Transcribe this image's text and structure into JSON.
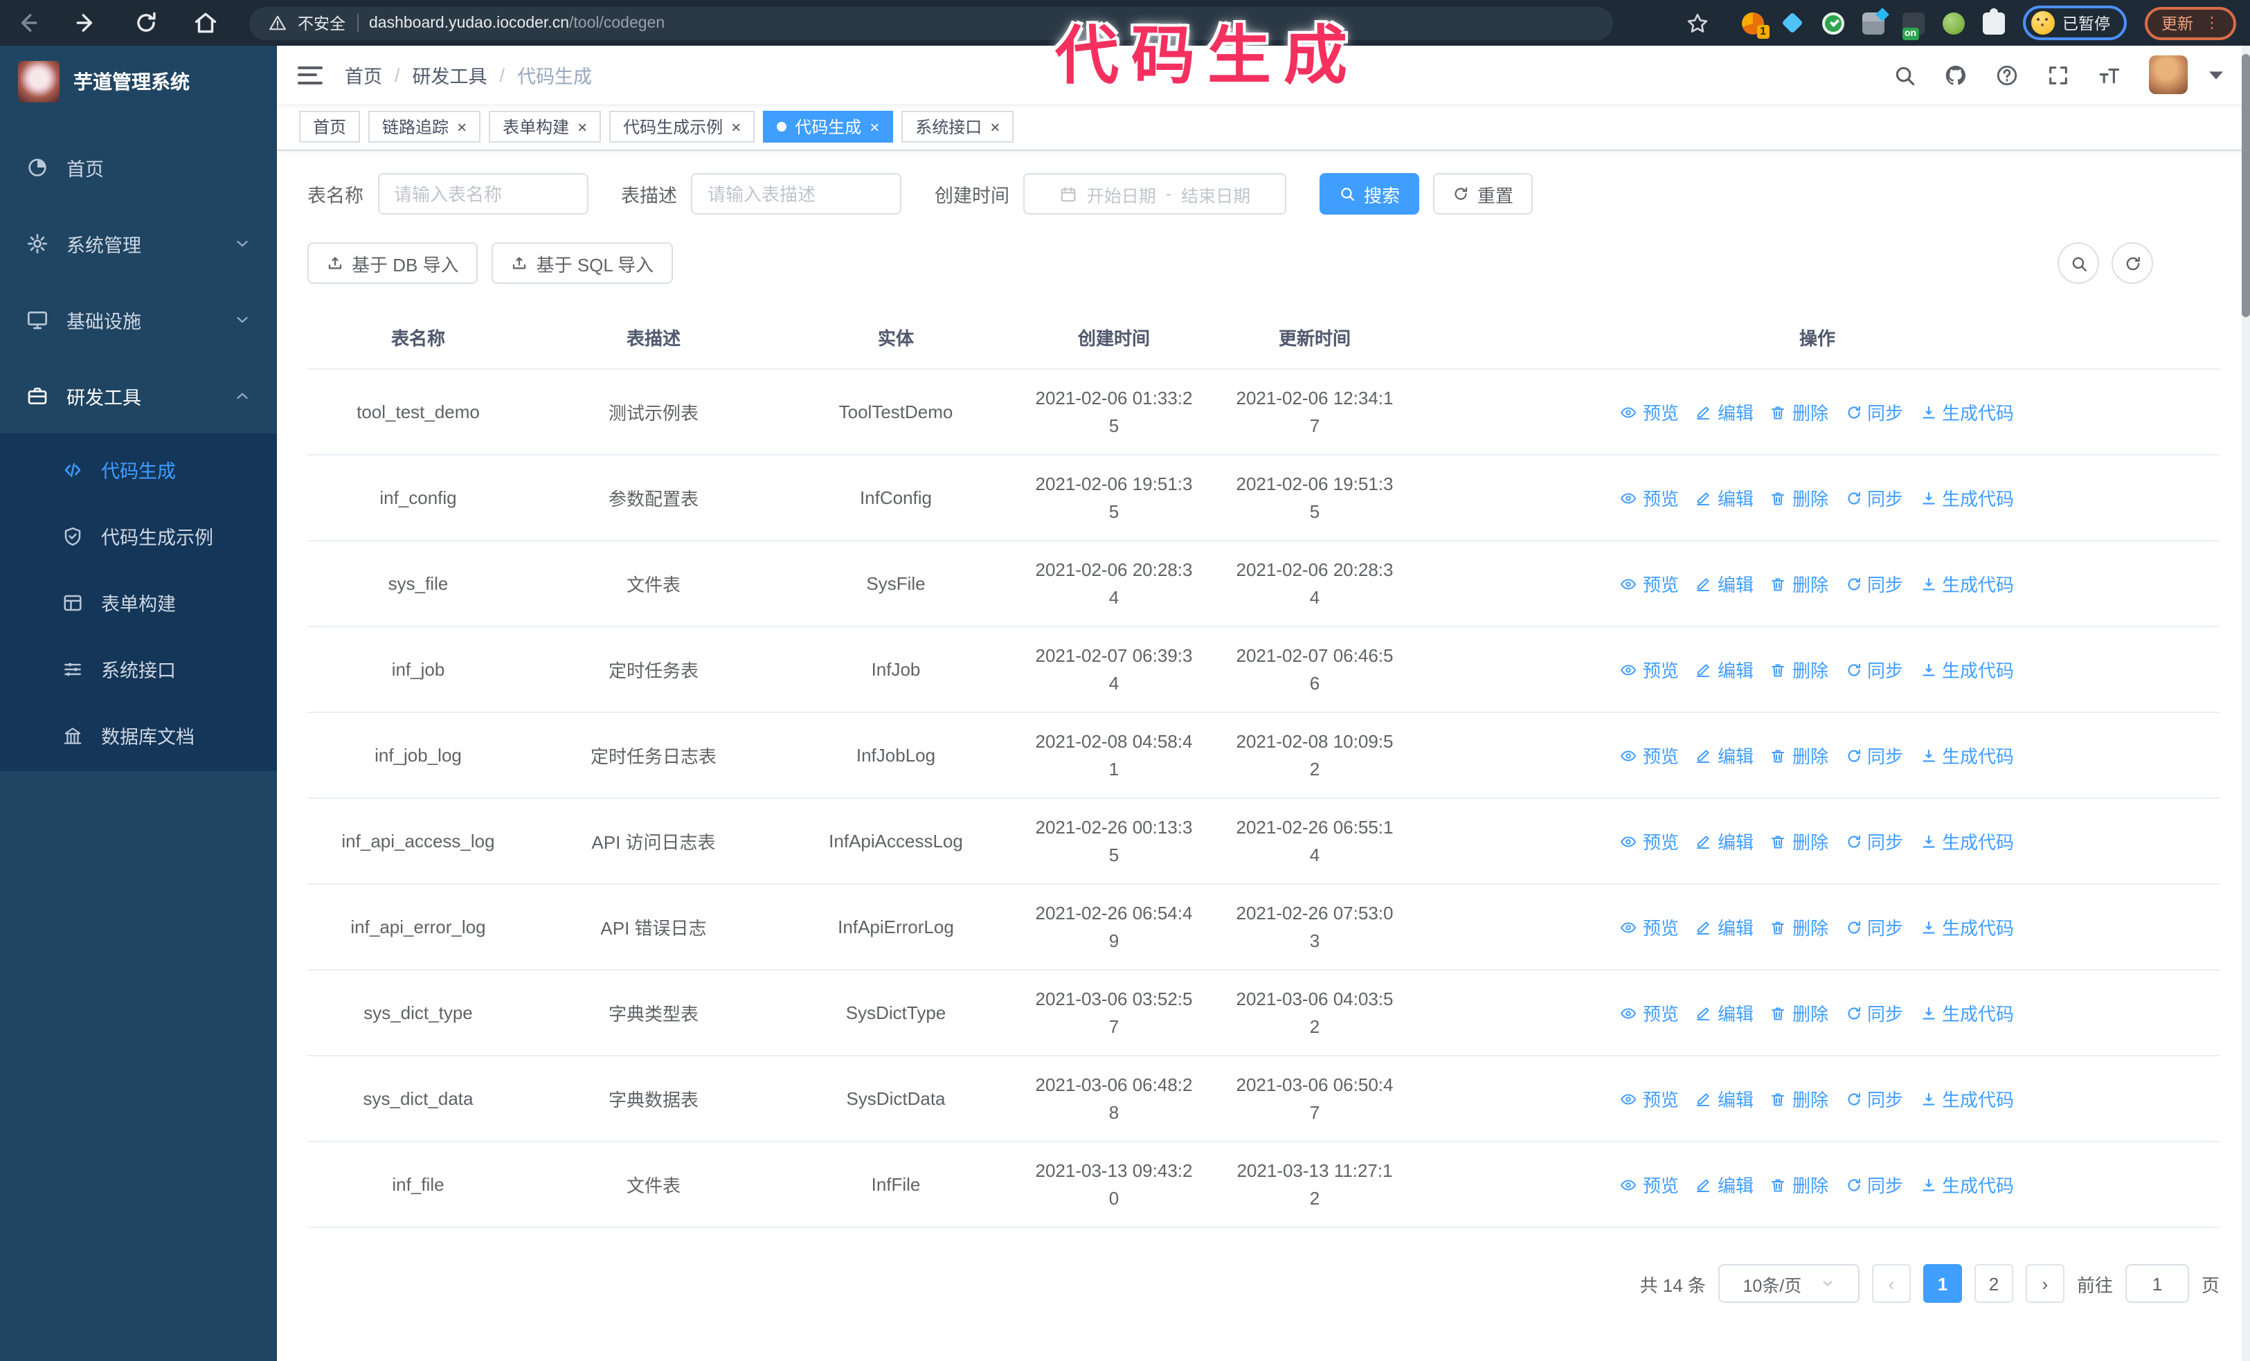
{
  "browser": {
    "security": "不安全",
    "host": "dashboard.yudao.iocoder.cn",
    "path": "/tool/codegen",
    "ext_badge": "1",
    "on_badge": "on",
    "paused": "已暂停",
    "update": "更新",
    "menu_glyph": "⋮"
  },
  "annotation": {
    "text": "代码生成"
  },
  "sidebar": {
    "title": "芋道管理系统",
    "items": [
      {
        "id": "home",
        "label": "首页",
        "icon": "dashboard",
        "expandable": false,
        "expanded": false
      },
      {
        "id": "system",
        "label": "系统管理",
        "icon": "gear",
        "expandable": true,
        "expanded": false
      },
      {
        "id": "infra",
        "label": "基础设施",
        "icon": "monitor",
        "expandable": true,
        "expanded": false
      },
      {
        "id": "dev-tools",
        "label": "研发工具",
        "icon": "toolbox",
        "expandable": true,
        "expanded": true
      }
    ],
    "submenu": [
      {
        "id": "codegen",
        "label": "代码生成",
        "icon": "code",
        "active": true
      },
      {
        "id": "codegen-example",
        "label": "代码生成示例",
        "icon": "shield",
        "active": false
      },
      {
        "id": "form-builder",
        "label": "表单构建",
        "icon": "form",
        "active": false
      },
      {
        "id": "system-api",
        "label": "系统接口",
        "icon": "sliders",
        "active": false
      },
      {
        "id": "db-doc",
        "label": "数据库文档",
        "icon": "bank",
        "active": false
      }
    ]
  },
  "topbar": {
    "breadcrumb": [
      "首页",
      "研发工具",
      "代码生成"
    ],
    "separator": "/"
  },
  "tabs": [
    {
      "label": "首页",
      "closable": false,
      "active": false
    },
    {
      "label": "链路追踪",
      "closable": true,
      "active": false
    },
    {
      "label": "表单构建",
      "closable": true,
      "active": false
    },
    {
      "label": "代码生成示例",
      "closable": true,
      "active": false
    },
    {
      "label": "代码生成",
      "closable": true,
      "active": true
    },
    {
      "label": "系统接口",
      "closable": true,
      "active": false
    }
  ],
  "search": {
    "table_name_label": "表名称",
    "table_name_placeholder": "请输入表名称",
    "table_desc_label": "表描述",
    "table_desc_placeholder": "请输入表描述",
    "create_time_label": "创建时间",
    "start_date_placeholder": "开始日期",
    "range_separator": "-",
    "end_date_placeholder": "结束日期",
    "search_label": "搜索",
    "reset_label": "重置"
  },
  "toolbar": {
    "import_db_label": "基于 DB 导入",
    "import_sql_label": "基于 SQL 导入"
  },
  "table": {
    "columns": [
      "表名称",
      "表描述",
      "实体",
      "创建时间",
      "更新时间",
      "操作"
    ],
    "actions": [
      "预览",
      "编辑",
      "删除",
      "同步",
      "生成代码"
    ],
    "rows": [
      {
        "name": "tool_test_demo",
        "desc": "测试示例表",
        "entity": "ToolTestDemo",
        "created": "2021-02-06 01:33:25",
        "updated": "2021-02-06 12:34:17"
      },
      {
        "name": "inf_config",
        "desc": "参数配置表",
        "entity": "InfConfig",
        "created": "2021-02-06 19:51:35",
        "updated": "2021-02-06 19:51:35"
      },
      {
        "name": "sys_file",
        "desc": "文件表",
        "entity": "SysFile",
        "created": "2021-02-06 20:28:34",
        "updated": "2021-02-06 20:28:34"
      },
      {
        "name": "inf_job",
        "desc": "定时任务表",
        "entity": "InfJob",
        "created": "2021-02-07 06:39:34",
        "updated": "2021-02-07 06:46:56"
      },
      {
        "name": "inf_job_log",
        "desc": "定时任务日志表",
        "entity": "InfJobLog",
        "created": "2021-02-08 04:58:41",
        "updated": "2021-02-08 10:09:52"
      },
      {
        "name": "inf_api_access_log",
        "desc": "API 访问日志表",
        "entity": "InfApiAccessLog",
        "created": "2021-02-26 00:13:35",
        "updated": "2021-02-26 06:55:14"
      },
      {
        "name": "inf_api_error_log",
        "desc": "API 错误日志",
        "entity": "InfApiErrorLog",
        "created": "2021-02-26 06:54:49",
        "updated": "2021-02-26 07:53:03"
      },
      {
        "name": "sys_dict_type",
        "desc": "字典类型表",
        "entity": "SysDictType",
        "created": "2021-03-06 03:52:57",
        "updated": "2021-03-06 04:03:52"
      },
      {
        "name": "sys_dict_data",
        "desc": "字典数据表",
        "entity": "SysDictData",
        "created": "2021-03-06 06:48:28",
        "updated": "2021-03-06 06:50:47"
      },
      {
        "name": "inf_file",
        "desc": "文件表",
        "entity": "InfFile",
        "created": "2021-03-13 09:43:20",
        "updated": "2021-03-13 11:27:12"
      }
    ]
  },
  "pagination": {
    "total": "共 14 条",
    "size": "10条/页",
    "prev_glyph": "‹",
    "next_glyph": "›",
    "pages": [
      "1",
      "2"
    ],
    "active": "1",
    "goto": "前往",
    "goto_value": "1",
    "unit": "页"
  },
  "icons": {
    "close": "×"
  },
  "colors": {
    "accent": "#409eff",
    "sidebar_bg": "#204563",
    "submenu_bg": "#143659",
    "annotation": "#f4305f",
    "chrome_bg": "#1e2a36"
  }
}
